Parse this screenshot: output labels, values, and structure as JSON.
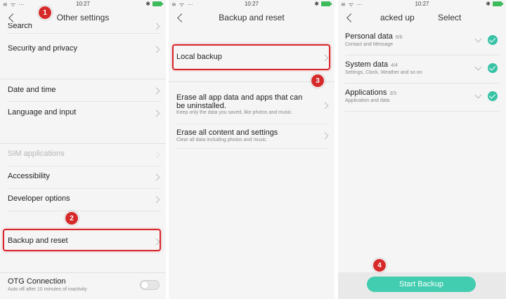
{
  "status": {
    "time": "10:27",
    "left_icons": "≋ ᯤ ⋯",
    "bt": "✱"
  },
  "panel1": {
    "title": "Other settings",
    "items": {
      "search": "Search",
      "security": "Security and privacy",
      "date": "Date and time",
      "language": "Language and input",
      "sim": "SIM applications",
      "accessibility": "Accessibility",
      "developer": "Developer options",
      "backup": "Backup and reset",
      "otg": "OTG Connection",
      "otg_sub": "Auto off after 10 minutes of inactivity"
    }
  },
  "panel2": {
    "title": "Backup and reset",
    "local_backup": "Local backup",
    "erase_apps": "Erase all app data and apps that can be uninstalled.",
    "erase_apps_sub": "Keep only the data you saved, like photos and music.",
    "erase_all": "Erase all content and settings",
    "erase_all_sub": "Clear all data including photos and music."
  },
  "panel3": {
    "title_left": "acked up",
    "title_right": "Select",
    "items": [
      {
        "label": "Personal data",
        "count": "6/6",
        "sub": "Contact and Message"
      },
      {
        "label": "System data",
        "count": "4/4",
        "sub": "Settings, Clock, Weather and so on"
      },
      {
        "label": "Applications",
        "count": "3/3",
        "sub": "Application and data"
      }
    ],
    "start_button": "Start Backup"
  },
  "badges": [
    "1",
    "2",
    "3",
    "4"
  ],
  "colors": {
    "accent": "#42cdb0",
    "highlight": "#d8262c",
    "badge": "#d62a2a"
  }
}
